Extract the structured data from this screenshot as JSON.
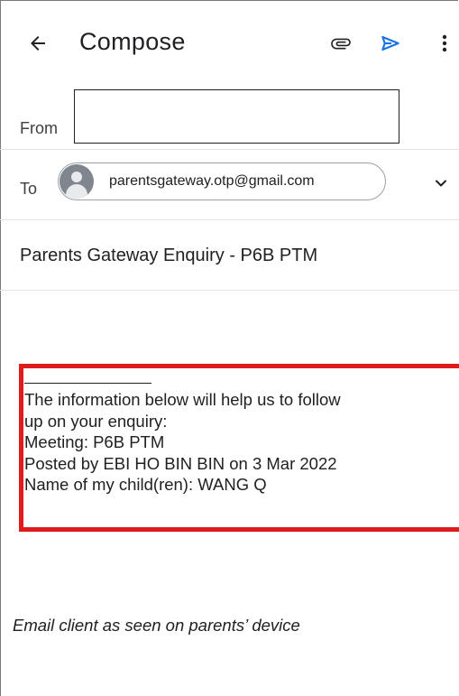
{
  "appbar": {
    "back_icon": "arrow-left-icon",
    "title": "Compose",
    "attach_icon": "paperclip-icon",
    "send_icon": "send-icon",
    "more_icon": "more-vertical-icon",
    "send_color": "#1a73e8"
  },
  "from": {
    "label": "From",
    "value": ""
  },
  "to": {
    "label": "To",
    "recipient": "parentsgateway.otp@gmail.com",
    "avatar_icon": "person-avatar-icon",
    "expand_icon": "chevron-down-icon"
  },
  "subject": {
    "value": "Parents Gateway Enquiry - P6B PTM"
  },
  "body": {
    "lines": [
      "The information below will help us to follow",
      "up on your enquiry:",
      "Meeting: P6B PTM",
      "Posted by EBI HO BIN BIN on 3 Mar 2022",
      "Name of my child(ren): WANG Q"
    ],
    "highlight_color": "#e01b1b"
  },
  "caption": "Email client as seen on parents’ device"
}
